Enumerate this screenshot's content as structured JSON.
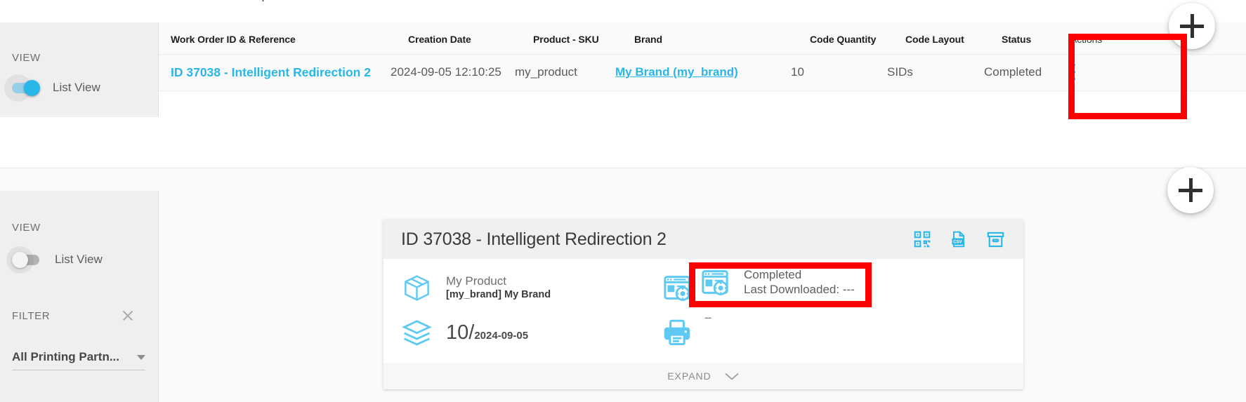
{
  "sidebar_top": {
    "view_label": "VIEW",
    "toggle_label": "List View",
    "toggle_state": "on"
  },
  "sidebar_bottom": {
    "view_label": "VIEW",
    "toggle_label": "List View",
    "toggle_state": "off",
    "filter_label": "FILTER",
    "printing_partner_value": "All Printing Partn..."
  },
  "table": {
    "columns": [
      "Work Order ID & Reference",
      "Creation Date",
      "Product - SKU",
      "Brand",
      "Code Quantity",
      "Code Layout",
      "Status",
      "Actions"
    ],
    "rows": [
      {
        "work_order": "ID 37038 - Intelligent Redirection 2",
        "creation_date": "2024-09-05 12:10:25",
        "product_sku": "my_product",
        "brand": "My Brand (my_brand)",
        "code_quantity": "10",
        "code_layout": "SIDs",
        "status": "Completed",
        "actions_icon": "kebab-menu-icon"
      }
    ]
  },
  "card": {
    "title": "ID 37038 - Intelligent Redirection 2",
    "header_icons": [
      {
        "name": "qr-code-icon"
      },
      {
        "name": "csv-file-icon"
      },
      {
        "name": "archive-box-icon"
      }
    ],
    "product": {
      "icon": "package-box-icon",
      "line1": "My Product",
      "line2": "[my_brand] My Brand"
    },
    "quantity": {
      "icon": "layers-stack-icon",
      "value": "10",
      "separator": "/",
      "date": "2024-09-05"
    },
    "status": {
      "icon": "browser-settings-icon",
      "line1": "Completed",
      "line2": "Last Downloaded: ---"
    },
    "printer": {
      "icon": "printer-icon",
      "value": "--"
    },
    "footer": {
      "expand_label": "EXPAND",
      "chevron_icon": "chevron-down-icon"
    }
  },
  "fabs": [
    {
      "name": "add-work-order-button-top",
      "icon": "plus-icon"
    },
    {
      "name": "add-work-order-button-bottom",
      "icon": "plus-icon"
    }
  ],
  "annotations": {
    "highlight_color": "#ff0000",
    "boxes": [
      {
        "name": "status-column-highlight"
      },
      {
        "name": "card-status-highlight"
      }
    ]
  },
  "colors": {
    "accent": "#29b6e8",
    "sidebar_bg": "#efefef",
    "table_bg": "#fafafa",
    "card_header_bg": "#f0f0f0"
  },
  "clipped_top_text": "· · · · · · · · \\ · · · · · / · · · · · · · | · · · · · · · ·"
}
